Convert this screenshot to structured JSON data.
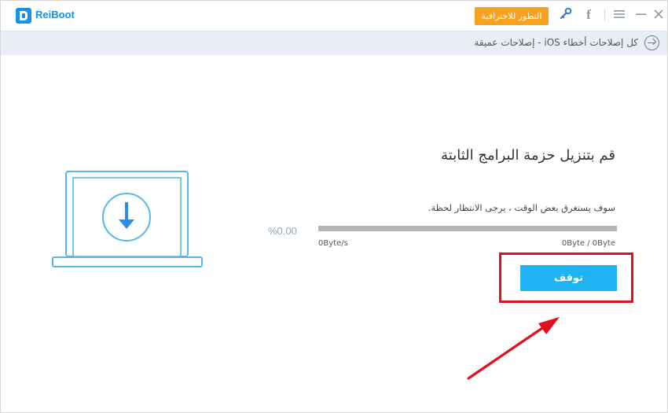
{
  "app": {
    "name": "ReiBoot",
    "upgrade_label": "التطور للاحترافية",
    "icons": {
      "logo": "reiboot-logo-icon",
      "key": "key-icon",
      "facebook": "facebook-icon",
      "menu": "menu-icon",
      "minimize": "minimize-icon",
      "close": "close-icon"
    },
    "colors": {
      "brand": "#1a8fe6",
      "upgrade": "#f6a21e",
      "button": "#1fb3f3",
      "highlight": "#e0101e"
    }
  },
  "breadcrumb": {
    "text": "كل إصلاحات أخطاء iOS - إصلاحات عميقة"
  },
  "download": {
    "title": "قم بتنزيل حزمة البرامج الثابتة",
    "description": "سوف يستغرق بعض الوقت ، يرجى الانتظار لحظة.",
    "percent_label": "%0.00",
    "progress": 0.0,
    "speed": "0Byte/s",
    "size": "0Byte / 0Byte",
    "stop_label": "توقف"
  }
}
